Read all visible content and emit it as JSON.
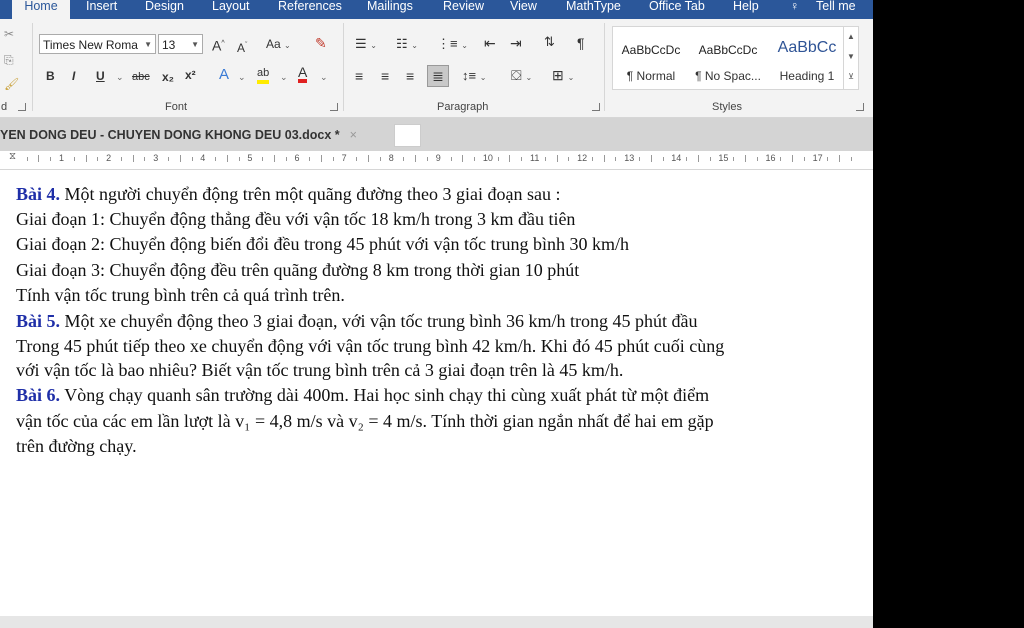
{
  "tabs": [
    "Home",
    "Insert",
    "Design",
    "Layout",
    "References",
    "Mailings",
    "Review",
    "View",
    "MathType",
    "Office Tab",
    "Help",
    "Tell me"
  ],
  "ribbon": {
    "clipboard_label": "d",
    "font": {
      "label": "Font",
      "family": "Times New Roma",
      "size": "13",
      "grow_label": "A",
      "shrink_label": "A",
      "case_label": "Aa",
      "bold": "B",
      "italic": "I",
      "underline": "U",
      "strike": "abc",
      "subscript": "x₂",
      "superscript": "x²",
      "effects": "A",
      "highlight": "ab",
      "color": "A"
    },
    "paragraph": {
      "label": "Paragraph"
    },
    "styles": {
      "label": "Styles",
      "items": [
        {
          "sample": "AaBbCcDc",
          "name": "¶ Normal"
        },
        {
          "sample": "AaBbCcDc",
          "name": "¶ No Spac..."
        },
        {
          "sample": "AaBbCc",
          "name": "Heading 1"
        }
      ]
    }
  },
  "doc_tab": {
    "title": "YEN DONG DEU - CHUYEN DONG KHONG DEU 03.docx *",
    "close": "×"
  },
  "ruler_numbers": [
    "1",
    "2",
    "3",
    "4",
    "5",
    "6",
    "7",
    "8",
    "9",
    "10",
    "11",
    "12",
    "13",
    "14",
    "15",
    "16",
    "17"
  ],
  "document": {
    "p1_label": "Bài 4.",
    "p1_text": " Một người chuyển động trên một quãng đường theo 3 giai đoạn sau :",
    "p2": "Giai đoạn 1: Chuyển động thẳng đều với vận tốc 18 km/h trong 3 km đầu tiên",
    "p3": "Giai đoạn 2: Chuyển động biến đổi đều trong 45 phút với vận tốc trung bình 30 km/h",
    "p4": "Giai đoạn 3: Chuyển động đều trên quãng đường 8 km trong thời gian 10 phút",
    "p5": "Tính vận tốc trung bình trên cả quá trình trên.",
    "p6_label": "Bài 5.",
    "p6_text": " Một xe chuyển động theo 3 giai đoạn, với vận tốc trung bình 36 km/h trong 45 phút đầu",
    "p7": "Trong 45 phút tiếp theo xe chuyển động với vận tốc trung bình 42 km/h. Khi đó 45 phút cuối cùng",
    "p8": "với vận tốc là bao nhiêu? Biết vận tốc trung bình trên cả 3 giai đoạn trên là 45 km/h.",
    "p9_label": "Bài 6.",
    "p9_text": " Vòng chạy quanh sân trường dài 400m. Hai học sinh chạy thi cùng xuất phát từ một điểm",
    "p10": "vận tốc của các em lần lượt là v₁ = 4,8 m/s và v₂ = 4 m/s. Tính thời gian ngắn nhất để hai em gặp",
    "p11": "trên đường chạy."
  }
}
